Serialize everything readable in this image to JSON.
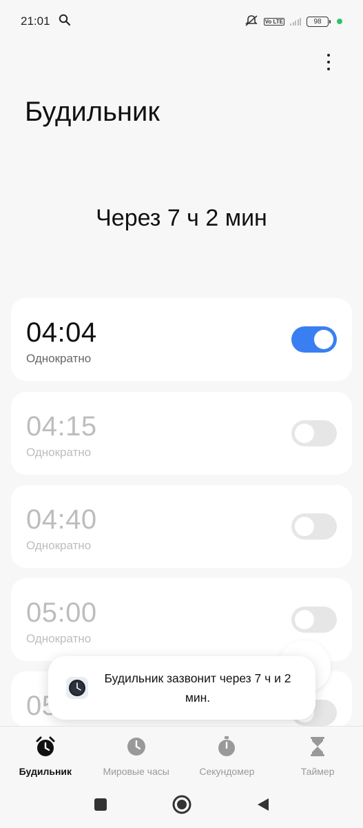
{
  "status_bar": {
    "time": "21:01",
    "volte": "Vo LTE",
    "battery": "98",
    "icons": [
      "search-icon",
      "vibrate-off-icon",
      "signal-icon",
      "battery-icon"
    ]
  },
  "header": {
    "title": "Будильник",
    "menu_icon": "more-vertical-icon"
  },
  "countdown": "Через 7 ч 2 мин",
  "alarms": [
    {
      "time": "04:04",
      "repeat": "Однократно",
      "enabled": true
    },
    {
      "time": "04:15",
      "repeat": "Однократно",
      "enabled": false
    },
    {
      "time": "04:40",
      "repeat": "Однократно",
      "enabled": false
    },
    {
      "time": "05:00",
      "repeat": "Однократно",
      "enabled": false
    },
    {
      "time": "05",
      "repeat": "",
      "enabled": false
    }
  ],
  "toast": {
    "text": "Будильник зазвонит через 7 ч и 2 мин.",
    "icon": "clock-icon"
  },
  "bottom_nav": [
    {
      "label": "Будильник",
      "icon": "alarm-icon",
      "active": true
    },
    {
      "label": "Мировые часы",
      "icon": "world-clock-icon",
      "active": false
    },
    {
      "label": "Секундомер",
      "icon": "stopwatch-icon",
      "active": false
    },
    {
      "label": "Таймер",
      "icon": "hourglass-icon",
      "active": false
    }
  ],
  "colors": {
    "accent": "#3a7ff2",
    "background": "#f7f7f7",
    "card": "#ffffff",
    "inactive_text": "#bdbdbd"
  }
}
